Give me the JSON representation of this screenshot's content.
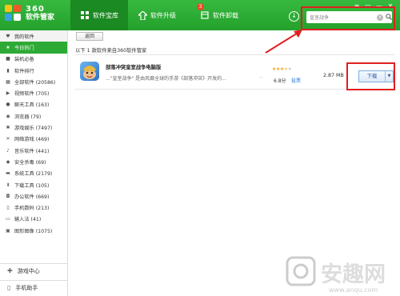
{
  "header": {
    "logo_line1": "360",
    "logo_line2": "软件管家",
    "tabs": [
      {
        "label": "软件宝库",
        "active": true
      },
      {
        "label": "软件升级",
        "badge": "3"
      },
      {
        "label": "软件卸载"
      }
    ],
    "search": {
      "placeholder": "皇室战争"
    }
  },
  "sidebar": {
    "items": [
      {
        "label": "我的软件",
        "icon": "heart"
      },
      {
        "label": "今日热门",
        "icon": "star"
      },
      {
        "label": "装机必备",
        "icon": "box"
      },
      {
        "label": "软件排行",
        "icon": "rank"
      },
      {
        "label": "全部软件 (20586)",
        "icon": "grid"
      },
      {
        "label": "视频软件 (705)",
        "icon": "video"
      },
      {
        "label": "聊天工具 (163)",
        "icon": "chat"
      },
      {
        "label": "浏览器 (79)",
        "icon": "browser"
      },
      {
        "label": "游戏娱乐 (7497)",
        "icon": "game"
      },
      {
        "label": "网络游戏 (469)",
        "icon": "netgame"
      },
      {
        "label": "音乐软件 (441)",
        "icon": "music"
      },
      {
        "label": "安全杀毒 (69)",
        "icon": "shield"
      },
      {
        "label": "系统工具 (2179)",
        "icon": "tool"
      },
      {
        "label": "下载工具 (105)",
        "icon": "download"
      },
      {
        "label": "办公软件 (669)",
        "icon": "office"
      },
      {
        "label": "手机数码 (213)",
        "icon": "phone"
      },
      {
        "label": "输入法 (41)",
        "icon": "input"
      },
      {
        "label": "图形图像 (1075)",
        "icon": "image"
      }
    ],
    "bottom": [
      {
        "label": "游戏中心",
        "icon": "gamepad"
      },
      {
        "label": "手机助手",
        "icon": "mobile"
      }
    ]
  },
  "main": {
    "back_label": "返回",
    "result_text": "以下 1 款软件来自360软件管家",
    "app": {
      "name": "部落冲突皇室战争电脑版",
      "description": "...\"皇室战争\" 是由风靡全球的手游《部落冲突》开发的...",
      "more": "...",
      "rating": "6.8分",
      "stars": 3.5,
      "vote_label": "投票",
      "size": "2.87 MB",
      "download_label": "下载"
    }
  },
  "watermark": {
    "text": "安趣网",
    "url": "www.anqu.com"
  },
  "colors": {
    "brand_green": "#2daa35",
    "highlight_red": "#e02020"
  }
}
